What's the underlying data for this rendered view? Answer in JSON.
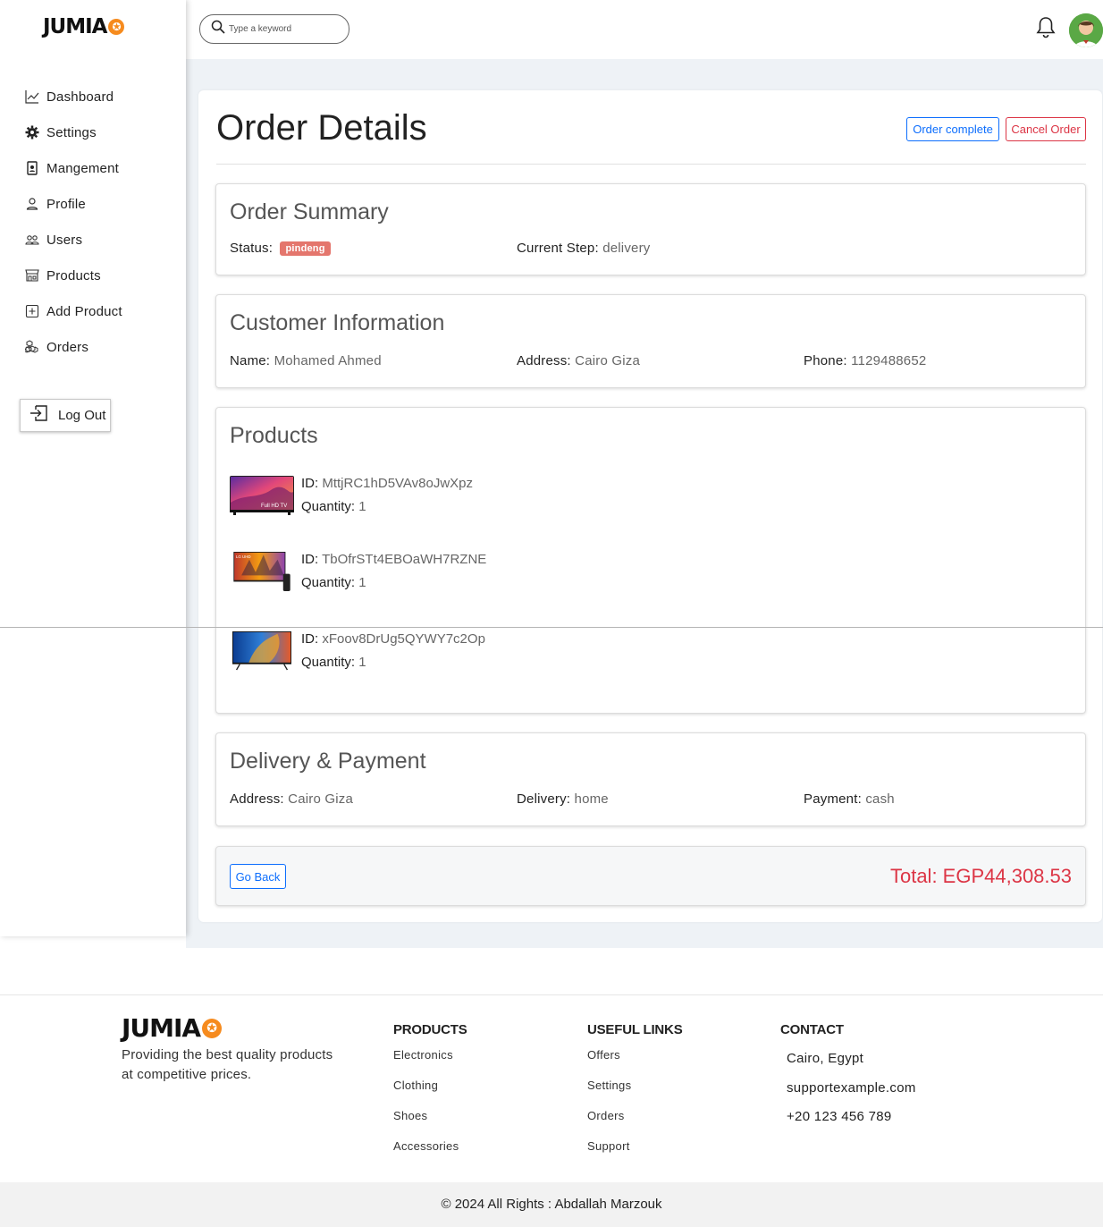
{
  "brand": {
    "name": "JUMIA",
    "star": "✪"
  },
  "search": {
    "placeholder": "Type a keyword"
  },
  "sidebar": {
    "items": [
      {
        "label": "Dashboard",
        "icon": "chart-line-icon"
      },
      {
        "label": "Settings",
        "icon": "gear-icon"
      },
      {
        "label": "Mangement",
        "icon": "id-card-icon"
      },
      {
        "label": "Profile",
        "icon": "person-icon"
      },
      {
        "label": "Users",
        "icon": "people-icon"
      },
      {
        "label": "Products",
        "icon": "shop-icon"
      },
      {
        "label": "Add Product",
        "icon": "plus-square-icon"
      },
      {
        "label": "Orders",
        "icon": "boxes-icon"
      }
    ],
    "logout_label": "Log Out"
  },
  "page": {
    "title": "Order Details",
    "order_complete_label": "Order complete",
    "cancel_order_label": "Cancel Order"
  },
  "summary": {
    "heading": "Order Summary",
    "status_label": "Status:",
    "status_value": "pindeng",
    "step_label": "Current Step:",
    "step_value": "delivery"
  },
  "customer": {
    "heading": "Customer Information",
    "name_label": "Name:",
    "name_value": "Mohamed Ahmed",
    "address_label": "Address:",
    "address_value": "Cairo Giza",
    "phone_label": "Phone:",
    "phone_value": "1129488652"
  },
  "products": {
    "heading": "Products",
    "id_label": "ID:",
    "qty_label": "Quantity:",
    "items": [
      {
        "id": "MttjRC1hD5VAv8oJwXpz",
        "quantity": "1",
        "badge": "Full HD TV"
      },
      {
        "id": "TbOfrSTt4EBOaWH7RZNE",
        "quantity": "1",
        "badge": "LG UHD"
      },
      {
        "id": "xFoov8DrUg5QYWY7c2Op",
        "quantity": "1",
        "badge": ""
      }
    ]
  },
  "delivery": {
    "heading": "Delivery & Payment",
    "address_label": "Address:",
    "address_value": "Cairo Giza",
    "delivery_label": "Delivery:",
    "delivery_value": "home",
    "payment_label": "Payment:",
    "payment_value": "cash"
  },
  "footer_bar": {
    "go_back_label": "Go Back",
    "total": "Total: EGP44,308.53"
  },
  "site_footer": {
    "tagline": "Providing the best quality products at competitive prices.",
    "products_heading": "PRODUCTS",
    "products_links": [
      "Electronics",
      "Clothing",
      "Shoes",
      "Accessories"
    ],
    "useful_heading": "USEFUL LINKS",
    "useful_links": [
      "Offers",
      "Settings",
      "Orders",
      "Support"
    ],
    "contact_heading": "CONTACT",
    "contact_city": "Cairo, Egypt",
    "contact_email": "supportexample.com",
    "contact_phone": "+20 123 456 789",
    "copyright": "© 2024 All Rights : Abdallah Marzouk"
  },
  "colors": {
    "accent": "#0d6efd",
    "danger": "#dc3545",
    "brand_orange": "#f68b1e",
    "status_badge": "#e4766d"
  }
}
